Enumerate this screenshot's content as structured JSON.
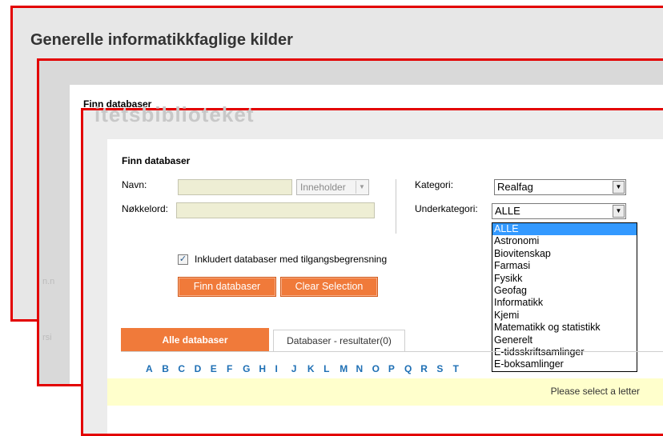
{
  "back": {
    "title": "Generelle informatikkfaglige kilder",
    "ghost": "itetsbiblioteket"
  },
  "middle": {
    "heading": "Finn databaser",
    "ghost_side": "rsi",
    "ghost_side2": "n.n"
  },
  "front": {
    "ghost": "itetsbiblioteket",
    "title": "Finn databaser",
    "navn_label": "Navn:",
    "navn_value": "",
    "mode_value": "Inneholder",
    "keyword_label": "Nøkkelord:",
    "keyword_value": "",
    "category_label": "Kategori:",
    "category_value": "Realfag",
    "subcategory_label": "Underkategori:",
    "subcategory_value": "ALLE",
    "subcategory_options": [
      "ALLE",
      "Astronomi",
      "Biovitenskap",
      "Farmasi",
      "Fysikk",
      "Geofag",
      "Informatikk",
      "Kjemi",
      "Matematikk og statistikk",
      "Generelt",
      "E-tidsskriftsamlinger",
      "E-boksamlinger"
    ],
    "include_restricted_label": "Inkludert databaser med tilgangsbegrensning",
    "include_restricted_checked": true,
    "find_button": "Finn databaser",
    "clear_button": "Clear Selection",
    "tab_all": "Alle databaser",
    "tab_results": "Databaser - resultater(0)",
    "letters": [
      "A",
      "B",
      "C",
      "D",
      "E",
      "F",
      "G",
      "H",
      "I",
      "J",
      "K",
      "L",
      "M",
      "N",
      "O",
      "P",
      "Q",
      "R",
      "S",
      "T"
    ],
    "notice": "Please select a letter",
    "accent_color": "#f07a3a",
    "highlight_color": "#ffffcc",
    "frame_color": "#e30000"
  }
}
